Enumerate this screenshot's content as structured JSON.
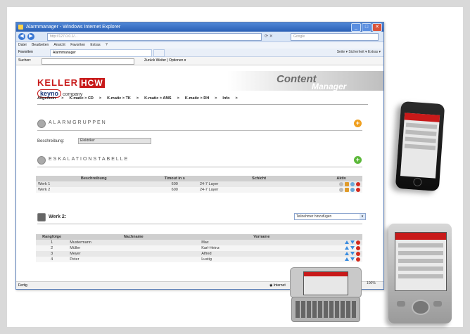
{
  "browser": {
    "window_title": "Alarmmanager - Windows Internet Explorer",
    "url": "http://127.0.0.1/...",
    "search_placeholder": "Google",
    "menu": [
      "Datei",
      "Bearbeiten",
      "Ansicht",
      "Favoriten",
      "Extras",
      "?"
    ],
    "favorites_label": "Favoriten",
    "tab_label": "Alarmmanager",
    "toolbar_right": "Seite ▾  Sicherheit ▾  Extras ▾",
    "find_label": "Suchen:",
    "find_extras": "Zurück  Weiter  |  Optionen ▾",
    "status_left": "Fertig",
    "status_zone": "Internet",
    "status_zoom": "100%"
  },
  "brand": {
    "keller": "KELLER",
    "hcw": "HCW",
    "keyno": "keyno",
    "keyno_suffix": "company",
    "content": "Content",
    "manager": "Manager"
  },
  "nav": [
    "Allgemein",
    ">",
    "K-matic > CD",
    ">",
    "K-matic > TK",
    ">",
    "K-matic > AMS",
    ">",
    "K-matic > DH",
    ">",
    "Info",
    ">"
  ],
  "alarmgruppen": {
    "title": "ALARMGRUPPEN",
    "beschreibung_label": "Beschreibung:",
    "beschreibung_value": "Elektriker"
  },
  "eskalation": {
    "title": "ESKALATIONSTABELLE",
    "headers": [
      "Beschreibung",
      "Timout in s",
      "Schicht",
      "Aktiv"
    ],
    "rows": [
      {
        "beschreibung": "Werk 1",
        "timeout": "600",
        "schicht": "24-7 Layer"
      },
      {
        "beschreibung": "Werk 2",
        "timeout": "600",
        "schicht": "24-7 Layer"
      }
    ]
  },
  "werk": {
    "title": "Werk 2:",
    "select_value": "Teilnehmer hinzufügen"
  },
  "teilnehmer": {
    "headers": [
      "Rangfolge",
      "Nachname",
      "Vorname"
    ],
    "rows": [
      {
        "rang": "1",
        "nachname": "Mustermann",
        "vorname": "Max"
      },
      {
        "rang": "2",
        "nachname": "Müller",
        "vorname": "Karl-Heinz"
      },
      {
        "rang": "3",
        "nachname": "Meyer",
        "vorname": "Alfred"
      },
      {
        "rang": "4",
        "nachname": "Peter",
        "vorname": "Lustig"
      }
    ]
  },
  "colors": {
    "brand_red": "#c81919",
    "add_orange": "#f0a020",
    "add_green": "#5cb83a",
    "delete_red": "#d32a1e"
  },
  "icons": [
    "alarm-group-icon",
    "escalation-icon",
    "worker-icon",
    "add-icon",
    "edit-icon",
    "info-icon",
    "delete-icon",
    "move-up-icon",
    "move-down-icon"
  ]
}
